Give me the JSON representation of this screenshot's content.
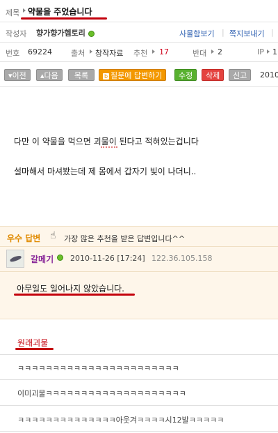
{
  "post": {
    "title_label": "제목",
    "title": "약물을 주었습니다",
    "author_label": "작성자",
    "author": "향가향가헴토리",
    "links": [
      "사물함보기",
      "쪽지보내기"
    ],
    "number_label": "번호",
    "number": "69224",
    "source_label": "출처",
    "source": "창작자료",
    "recommend_label": "추천",
    "recommend": "17",
    "oppose_label": "반대",
    "oppose": "2",
    "ip_label": "IP",
    "ip_partial": "1",
    "date_partial": "2010"
  },
  "toolbar": {
    "prev": "이전",
    "next": "다음",
    "list": "목록",
    "answer": "질문에 답변하기",
    "edit": "수정",
    "delete": "삭제",
    "report": "신고"
  },
  "body": {
    "line1": "다만 이 약물을 먹으면 괴물이 된다고 적혀있는겁니다",
    "line2": "설마해서 마셔봤는데 제 몸에서 갑자기 빛이 나더니.."
  },
  "best_answer": {
    "badge": "우수 답변",
    "note": "가장 많은 추천을 받은 답변입니다^^",
    "user": "갈메기",
    "datetime": "2010-11-26 [17:24]",
    "ip": "122.36.105.158",
    "text": "아무일도 일어나지 않았습니다."
  },
  "comments": [
    "원래괴물",
    "ㅋㅋㅋㅋㅋㅋㅋㅋㅋㅋㅋㅋㅋㅋㅋㅋㅋㅋㅋㅋㅋㅋㅋ",
    "이미괴물ㅋㅋㅋㅋㅋㅋㅋㅋㅋㅋㅋㅋㅋㅋㅋㅋㅋㅋㅋㅋ",
    "ㅋㅋㅋㅋㅋㅋㅋㅋㅋㅋㅋㅋㅋㅋ아웃겨ㅋㅋㅋㅋ시12발ㅋㅋㅋㅋㅋ"
  ],
  "colors": {
    "accent_red": "#c3000b",
    "link_blue": "#2a5db0",
    "user_purple": "#8a2a9a",
    "best_orange": "#e08a00"
  }
}
